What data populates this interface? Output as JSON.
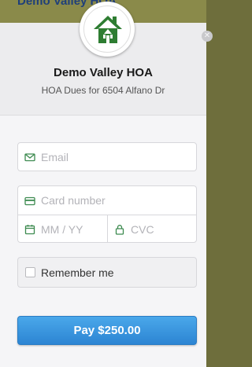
{
  "backdrop": {
    "title": "Demo Valley HOA"
  },
  "header": {
    "org_name": "Demo Valley HOA",
    "subtitle": "HOA Dues for 6504 Alfano Dr",
    "logo_icon": "house-icon",
    "close_icon": "close-icon"
  },
  "form": {
    "email": {
      "placeholder": "Email",
      "icon": "envelope-icon"
    },
    "card_number": {
      "placeholder": "Card number",
      "icon": "credit-card-icon"
    },
    "expiry": {
      "placeholder": "MM / YY",
      "icon": "calendar-icon"
    },
    "cvc": {
      "placeholder": "CVC",
      "icon": "lock-icon"
    },
    "remember": {
      "label": "Remember me",
      "checked": false
    }
  },
  "pay_button": {
    "label": "Pay $250.00"
  },
  "colors": {
    "accent": "#3b9be0",
    "icon_green": "#3c8a4f",
    "logo_green": "#2e7d32"
  }
}
